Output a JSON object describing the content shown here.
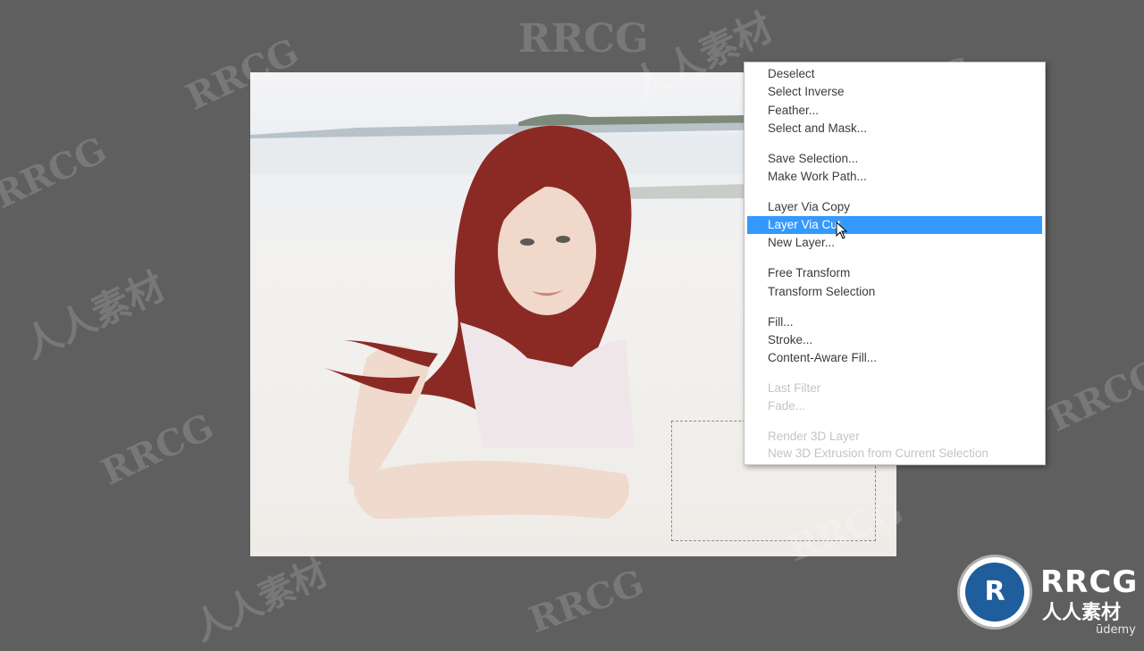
{
  "context_menu": {
    "items": [
      {
        "label": "Deselect",
        "state": "enabled"
      },
      {
        "label": "Select Inverse",
        "state": "enabled"
      },
      {
        "label": "Feather...",
        "state": "enabled"
      },
      {
        "label": "Select and Mask...",
        "state": "enabled"
      },
      {
        "label": "Save Selection...",
        "state": "enabled"
      },
      {
        "label": "Make Work Path...",
        "state": "enabled"
      },
      {
        "label": "Layer Via Copy",
        "state": "enabled"
      },
      {
        "label": "Layer Via Cut",
        "state": "selected"
      },
      {
        "label": "New Layer...",
        "state": "enabled"
      },
      {
        "label": "Free Transform",
        "state": "enabled"
      },
      {
        "label": "Transform Selection",
        "state": "enabled"
      },
      {
        "label": "Fill...",
        "state": "enabled"
      },
      {
        "label": "Stroke...",
        "state": "enabled"
      },
      {
        "label": "Content-Aware Fill...",
        "state": "enabled"
      },
      {
        "label": "Last Filter",
        "state": "disabled"
      },
      {
        "label": "Fade...",
        "state": "disabled"
      },
      {
        "label": "Render 3D Layer",
        "state": "disabled"
      },
      {
        "label": "New 3D Extrusion from Current Selection",
        "state": "disabled"
      }
    ],
    "highlight_color": "#3399ff"
  },
  "watermark": {
    "text_latin": "RRCG",
    "text_cn": "人人素材"
  },
  "logo": {
    "monogram": "R",
    "name": "RRCG",
    "subtitle": "人人素材"
  },
  "footer": {
    "brand": "ūdemy"
  },
  "colors": {
    "workspace_bg": "#5f5f5f",
    "menu_bg": "#ffffff",
    "hair": "#8b2a25"
  },
  "icons": [
    "mouse-pointer-icon",
    "rrcg-logo-icon"
  ]
}
